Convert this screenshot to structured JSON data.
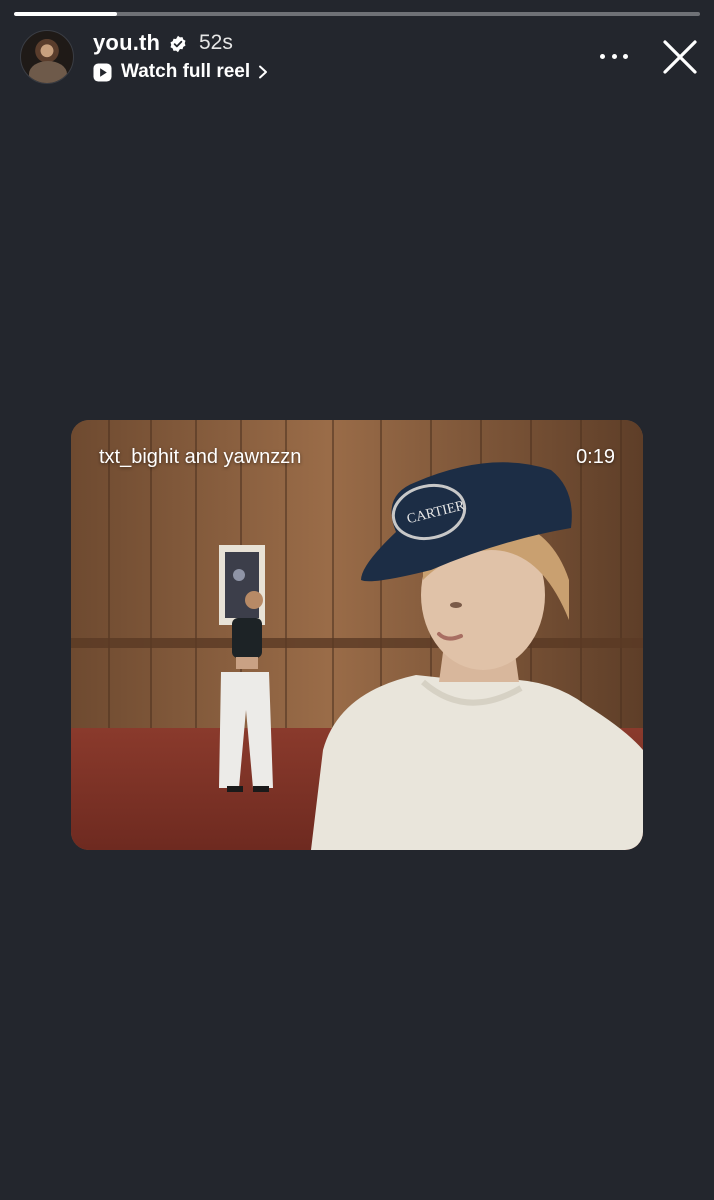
{
  "story": {
    "progress": 0.15
  },
  "header": {
    "username": "you.th",
    "verified": true,
    "time_ago": "52s",
    "watch_label": "Watch full reel",
    "icons": {
      "verified": "verified-badge-icon",
      "reel": "reel-play-icon",
      "chevron": "chevron-right-icon",
      "more": "more-options-icon",
      "close": "close-icon"
    }
  },
  "reel": {
    "title": "txt_bighit and yawnzzn",
    "duration": "0:19",
    "cap_text": "CARTIER"
  },
  "colors": {
    "background": "#23262d",
    "text": "#ffffff"
  }
}
